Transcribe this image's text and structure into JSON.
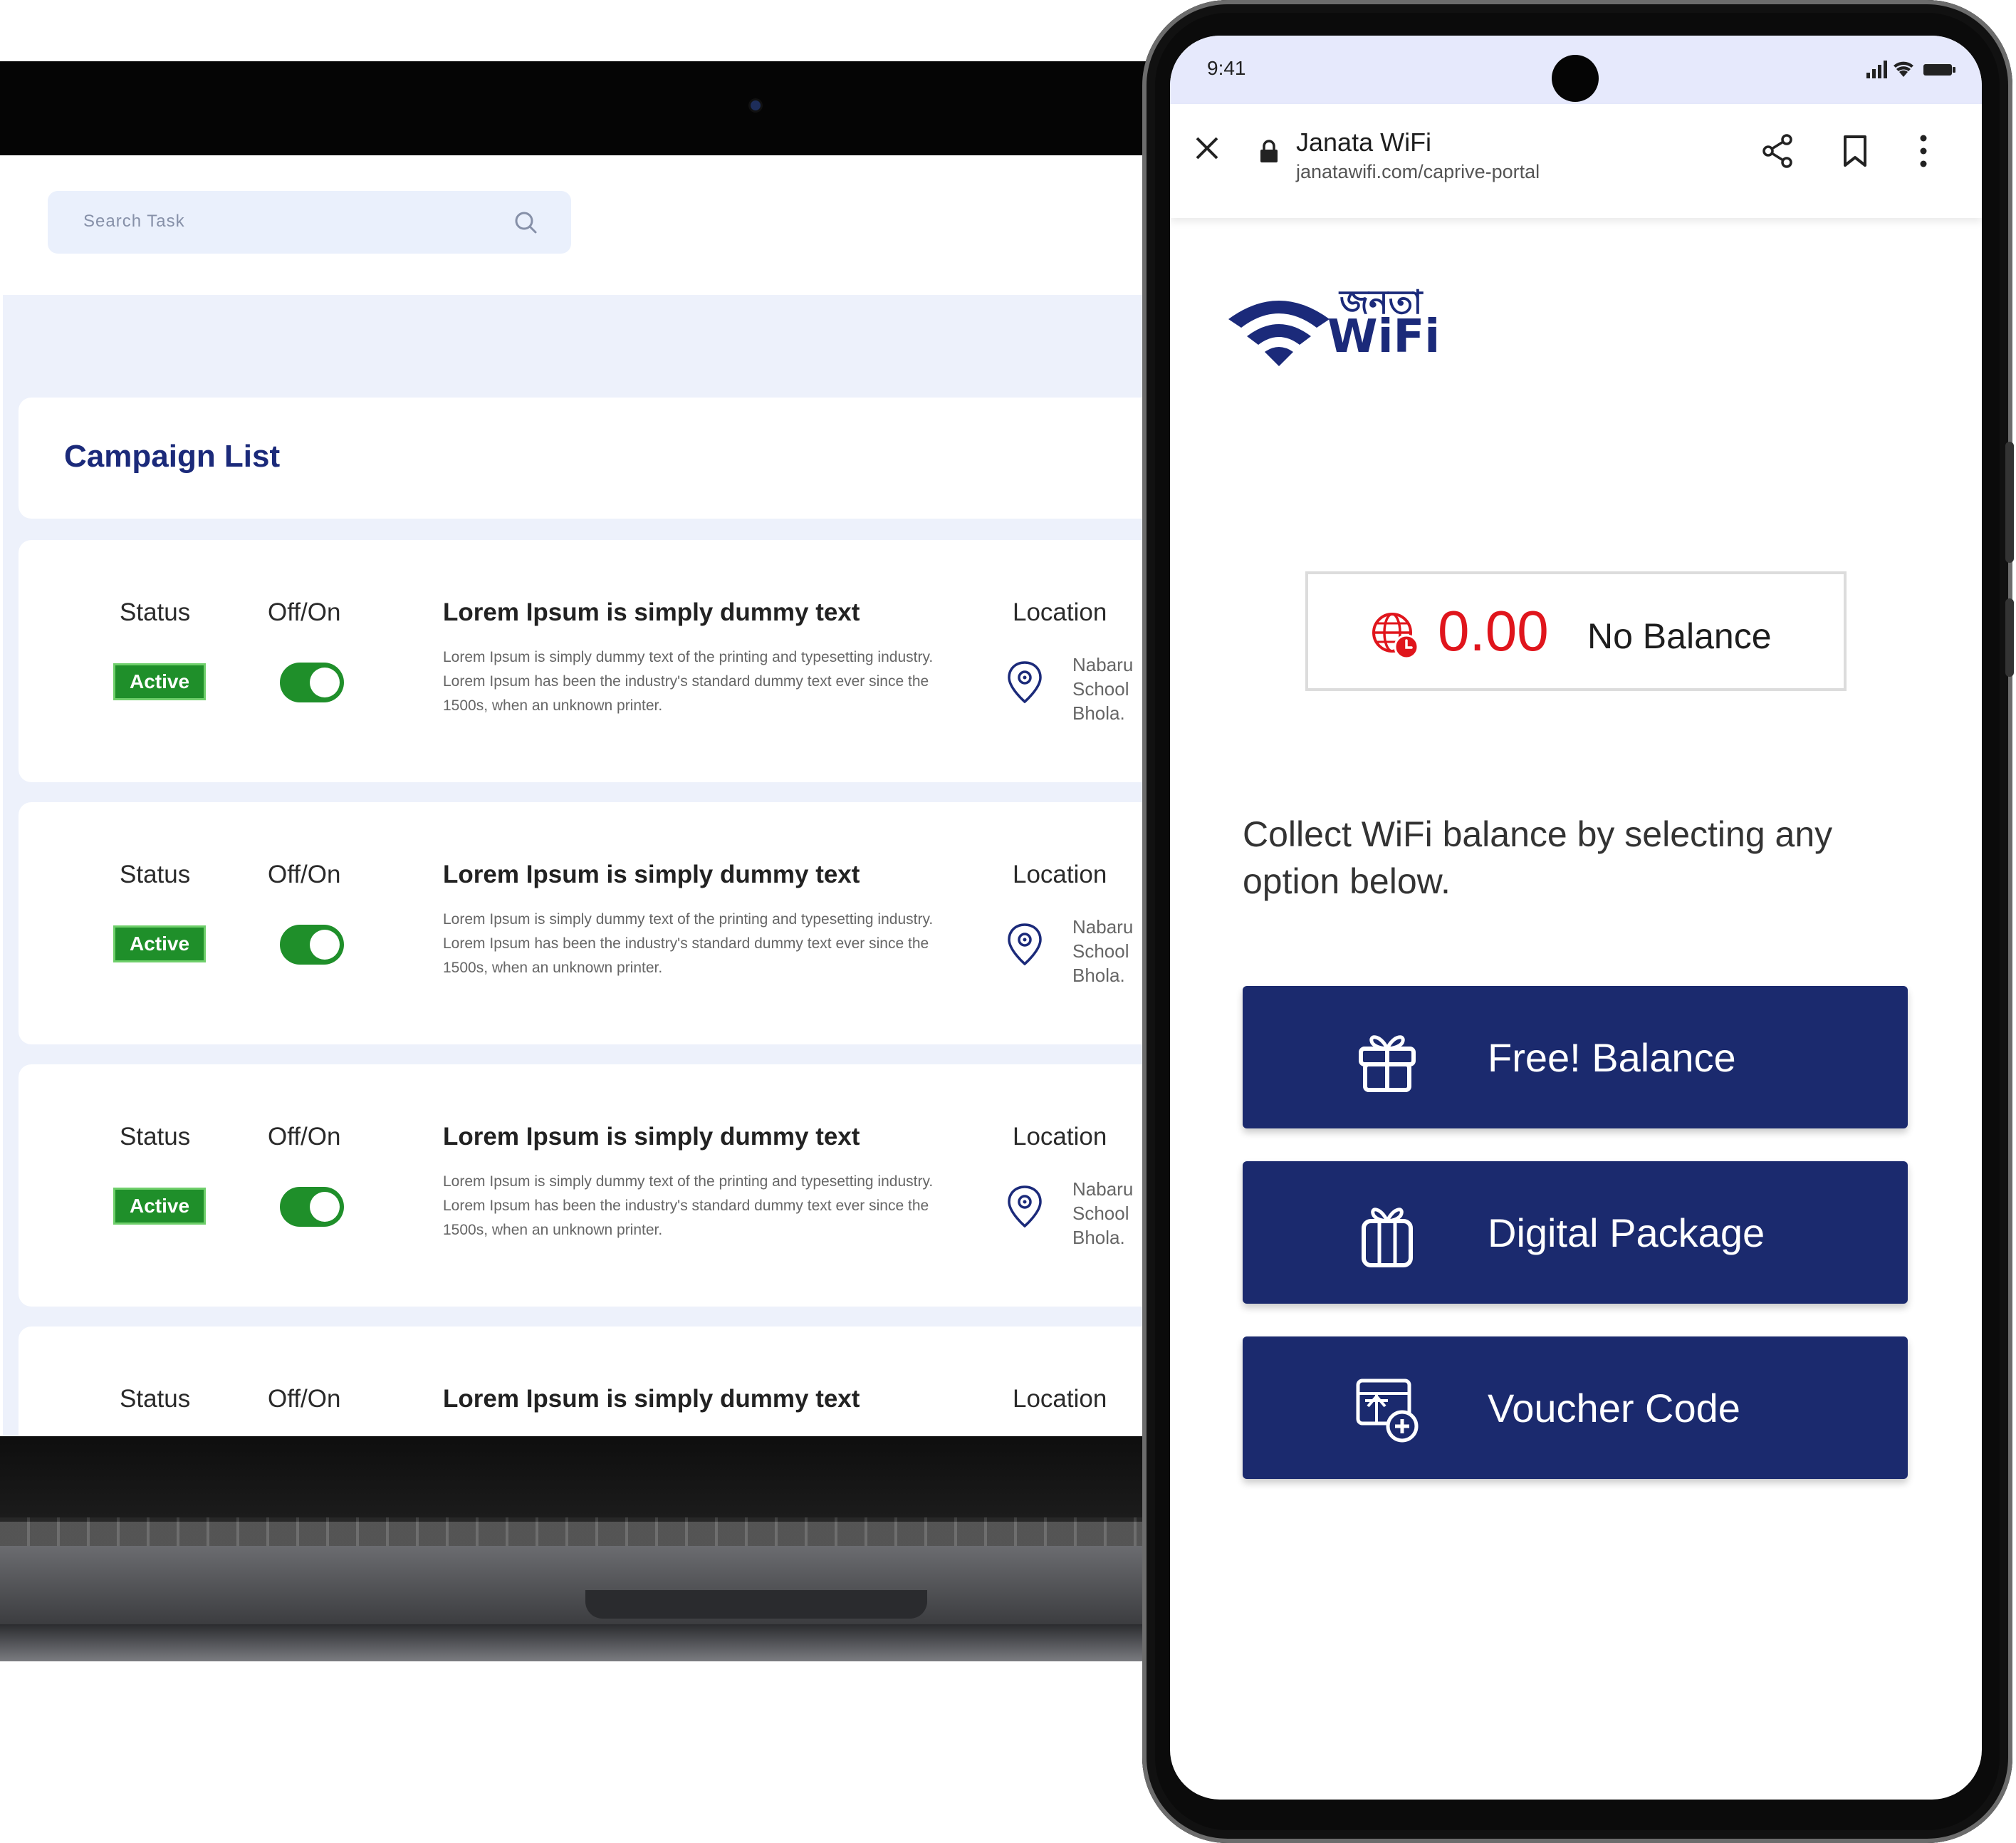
{
  "laptop": {
    "search": {
      "placeholder": "Search Task",
      "icon": "search-icon"
    },
    "title": "Campaign List",
    "columns": {
      "status": "Status",
      "toggle": "Off/On",
      "location": "Location"
    },
    "rows": [
      {
        "status": "Active",
        "toggle_on": true,
        "title": "Lorem Ipsum is simply dummy text",
        "description": "Lorem Ipsum is simply dummy text of the printing and typesetting industry. Lorem Ipsum has been the industry's standard dummy text ever since the 1500s, when an unknown printer.",
        "location": "Nabaru\nSchool\nBhola."
      },
      {
        "status": "Active",
        "toggle_on": true,
        "title": "Lorem Ipsum is simply dummy text",
        "description": "Lorem Ipsum is simply dummy text of the printing and typesetting industry. Lorem Ipsum has been the industry's standard dummy text ever since the 1500s, when an unknown printer.",
        "location": "Nabaru\nSchool\nBhola."
      },
      {
        "status": "Active",
        "toggle_on": true,
        "title": "Lorem Ipsum is simply dummy text",
        "description": "Lorem Ipsum is simply dummy text of the printing and typesetting industry. Lorem Ipsum has been the industry's standard dummy text ever since the 1500s, when an unknown printer.",
        "location": "Nabaru\nSchool\nBhola."
      },
      {
        "title": "Lorem Ipsum is simply dummy text"
      }
    ]
  },
  "phone": {
    "status_bar": {
      "time": "9:41"
    },
    "browser": {
      "site_title": "Janata WiFi",
      "url": "janatawifi.com/caprive-portal"
    },
    "logo": {
      "bengali": "জনতা",
      "text": "WiFi"
    },
    "balance": {
      "amount": "0.00",
      "label": "No Balance"
    },
    "instruction": "Collect WiFi balance by selecting any option below.",
    "options": [
      {
        "label": "Free! Balance",
        "icon": "gift-icon"
      },
      {
        "label": "Digital Package",
        "icon": "package-icon"
      },
      {
        "label": "Voucher Code",
        "icon": "voucher-icon"
      }
    ]
  },
  "colors": {
    "brand_navy": "#1b2a6e",
    "active_green": "#1f8f2a",
    "balance_red": "#e0151c",
    "page_bg": "#edf1fb"
  }
}
